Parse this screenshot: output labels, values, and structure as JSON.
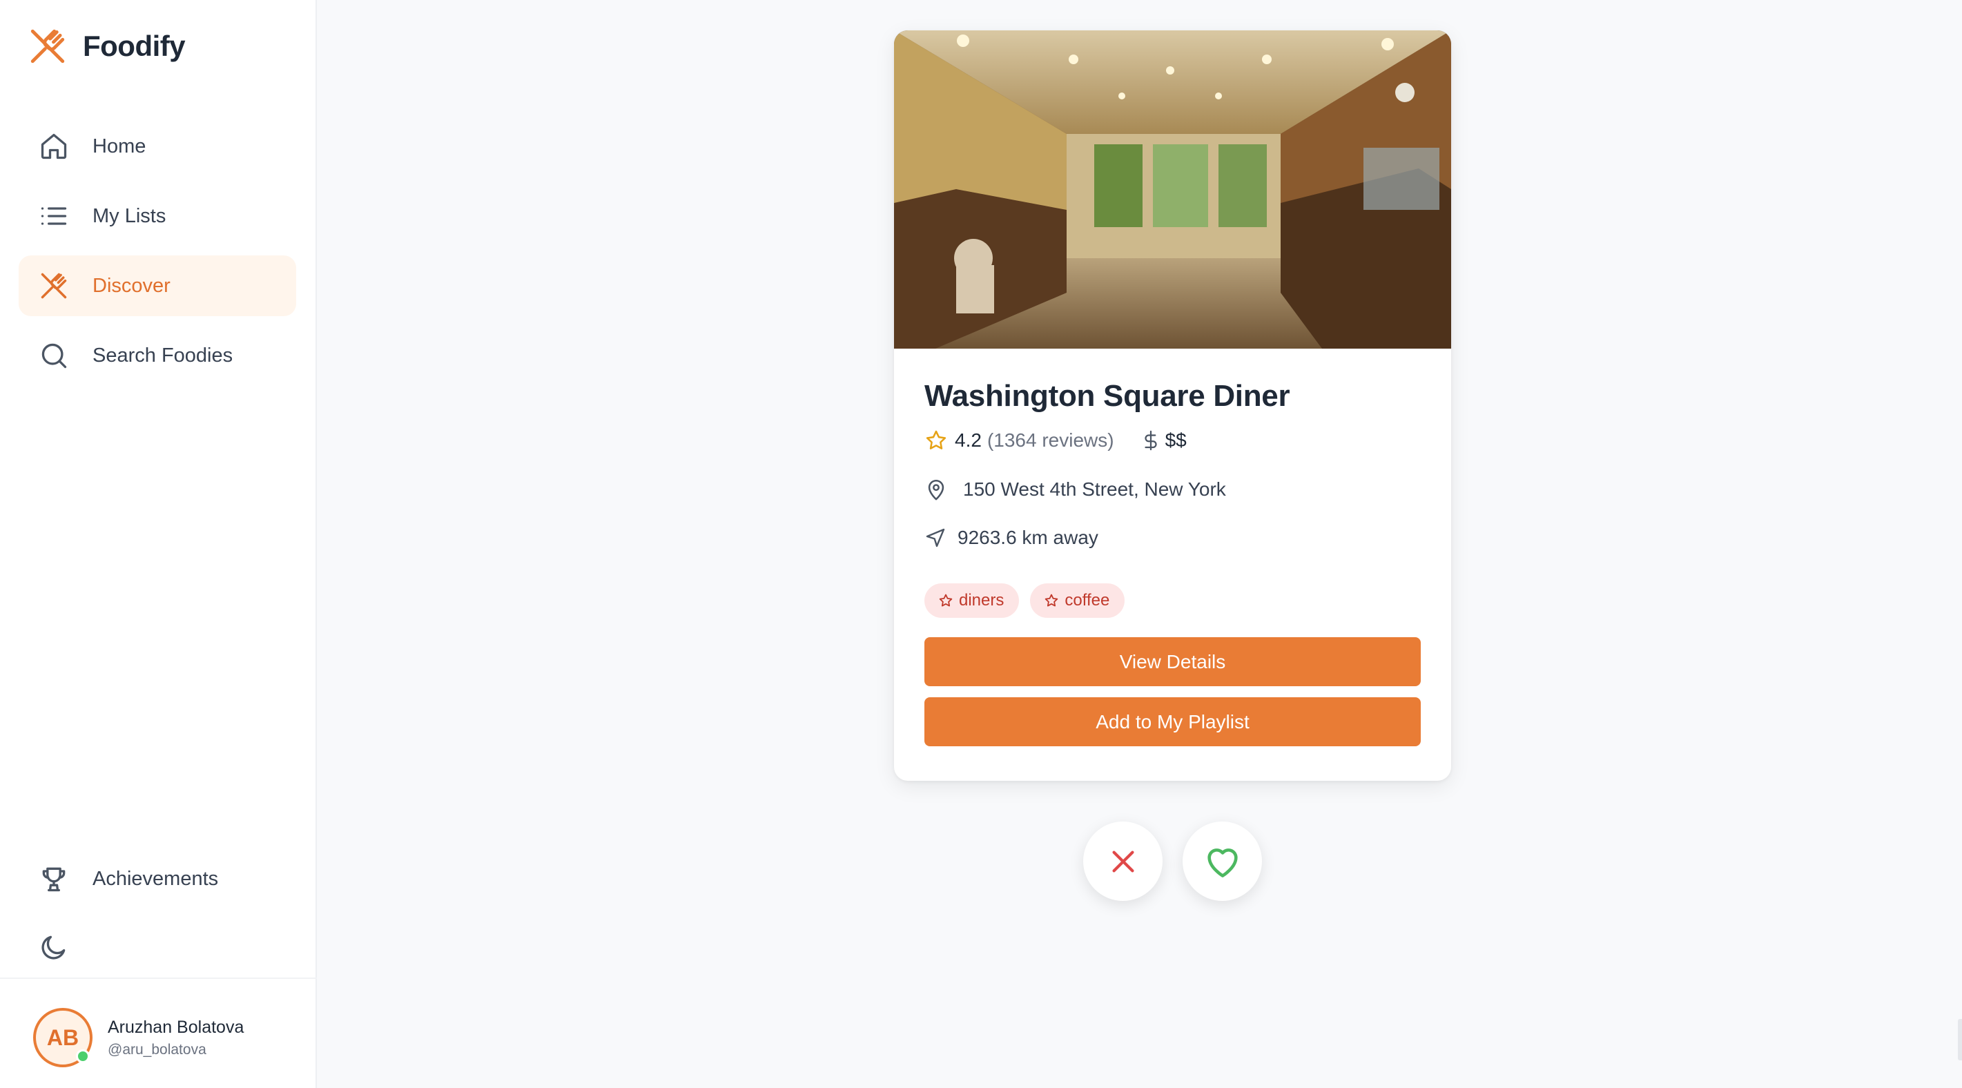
{
  "app": {
    "name": "Foodify",
    "logo_icon": "fork-knife-cross-icon",
    "accent": "#E97C35",
    "accent_text": "#E0702D"
  },
  "sidebar": {
    "items": [
      {
        "label": "Home",
        "icon": "home-icon",
        "active": false
      },
      {
        "label": "My Lists",
        "icon": "list-icon",
        "active": false
      },
      {
        "label": "Discover",
        "icon": "fork-knife-icon",
        "active": true
      },
      {
        "label": "Search Foodies",
        "icon": "search-icon",
        "active": false
      }
    ],
    "bottom_items": [
      {
        "label": "Achievements",
        "icon": "trophy-icon"
      },
      {
        "label": "",
        "icon": "moon-icon"
      }
    ]
  },
  "user": {
    "initials": "AB",
    "name": "Aruzhan Bolatova",
    "handle": "@aru_bolatova",
    "online": true
  },
  "restaurant": {
    "name": "Washington Square Diner",
    "rating": "4.2",
    "reviews": "(1364 reviews)",
    "price": "$$",
    "address": "150 West 4th Street, New York",
    "distance": "9263.6 km away",
    "tags": [
      "diners",
      "coffee"
    ]
  },
  "actions": {
    "view_details": "View Details",
    "add_playlist": "Add to My Playlist",
    "dislike_icon": "close-icon",
    "like_icon": "heart-icon",
    "dislike_color": "#E04848",
    "like_color": "#4CB860"
  }
}
